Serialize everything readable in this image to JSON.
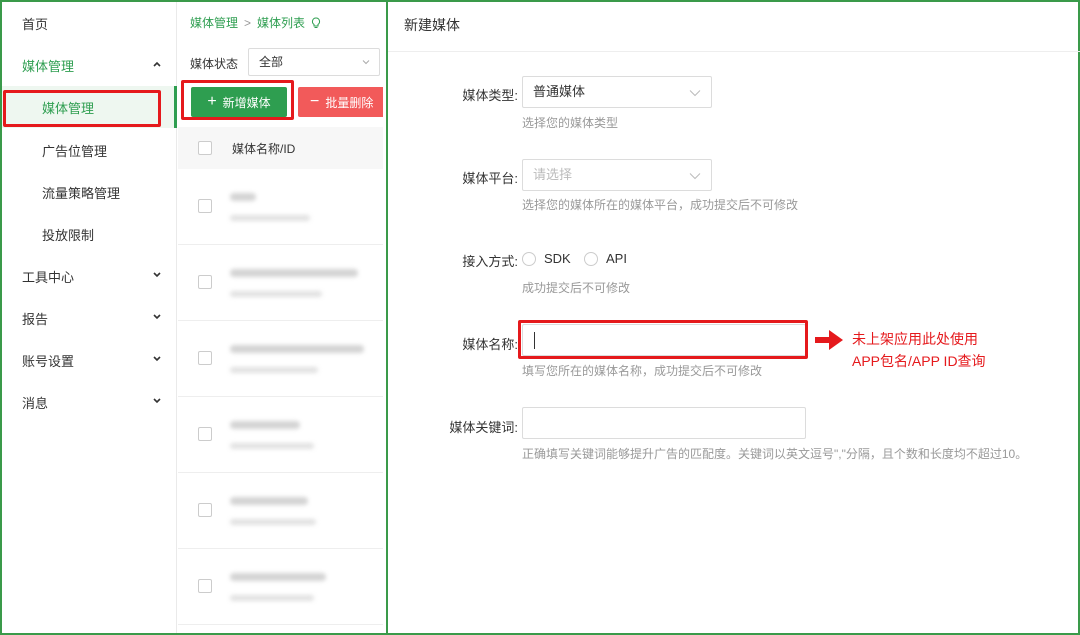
{
  "sidebar": {
    "items": [
      {
        "label": "首页"
      },
      {
        "label": "媒体管理"
      },
      {
        "label": "媒体管理"
      },
      {
        "label": "广告位管理"
      },
      {
        "label": "流量策略管理"
      },
      {
        "label": "投放限制"
      },
      {
        "label": "工具中心"
      },
      {
        "label": "报告"
      },
      {
        "label": "账号设置"
      },
      {
        "label": "消息"
      }
    ]
  },
  "list": {
    "breadcrumb": [
      "媒体管理",
      ">",
      "媒体列表"
    ],
    "filter_label": "媒体状态",
    "filter_value": "全部",
    "add_button": "新增媒体",
    "delete_button": "批量删除",
    "column_header": "媒体名称/ID",
    "row_count": 6
  },
  "form": {
    "title": "新建媒体",
    "media_type": {
      "label": "媒体类型:",
      "value": "普通媒体",
      "hint": "选择您的媒体类型"
    },
    "platform": {
      "label": "媒体平台:",
      "placeholder": "请选择",
      "hint": "选择您的媒体所在的媒体平台，成功提交后不可修改"
    },
    "access": {
      "label": "接入方式:",
      "options": [
        "SDK",
        "API"
      ],
      "hint": "成功提交后不可修改"
    },
    "name": {
      "label": "媒体名称:",
      "hint": "填写您所在的媒体名称，成功提交后不可修改"
    },
    "keywords": {
      "label": "媒体关键词:",
      "hint": "正确填写关键词能够提升广告的匹配度。关键词以英文逗号\",\"分隔，且个数和长度均不超过10。"
    }
  },
  "annotation": {
    "line1": "未上架应用此处使用",
    "line2": "APP包名/APP ID查询",
    "color": "#e5191c"
  },
  "colors": {
    "accent": "#2e9e50",
    "danger": "#f25a5a",
    "highlight": "#e5191c"
  }
}
